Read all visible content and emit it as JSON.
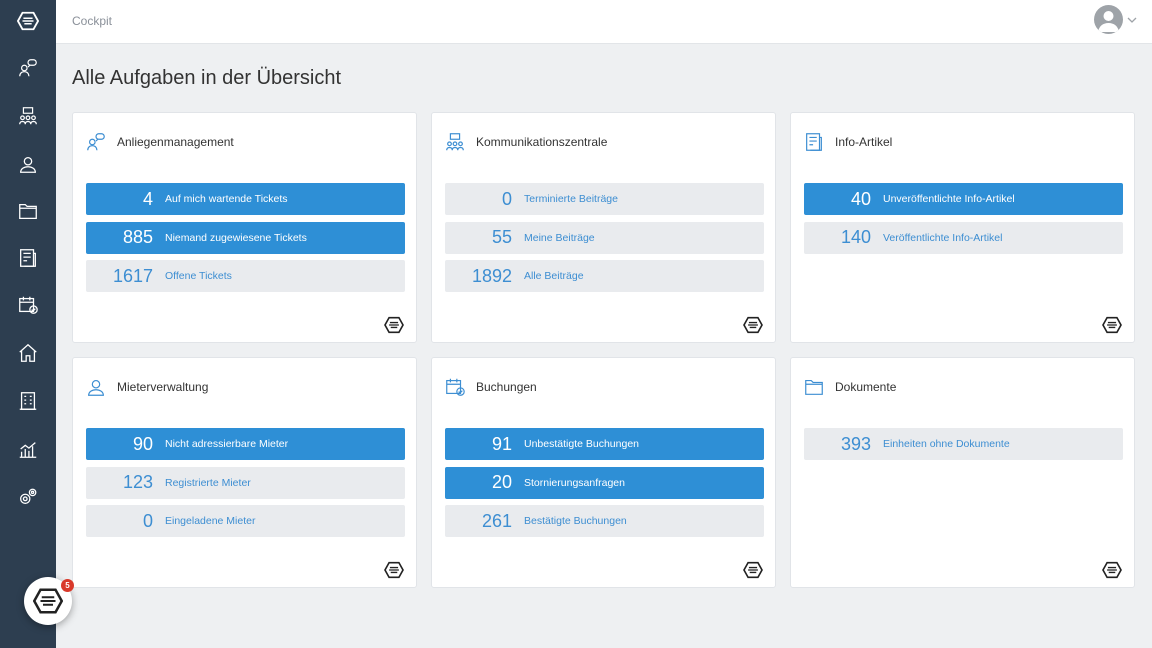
{
  "app": {
    "breadcrumb": "Cockpit",
    "page_title": "Alle Aufgaben in der Übersicht"
  },
  "colors": {
    "sidebar": "#2d3e50",
    "accent": "#2e8fd6",
    "link": "#3d8ed2",
    "row_muted": "#e9ebee",
    "badge": "#d9392b"
  },
  "sidebar": {
    "items": [
      {
        "icon": "logo-icon"
      },
      {
        "icon": "chat-person-icon"
      },
      {
        "icon": "people-group-icon"
      },
      {
        "icon": "person-icon"
      },
      {
        "icon": "folder-icon"
      },
      {
        "icon": "document-icon"
      },
      {
        "icon": "calendar-check-icon"
      },
      {
        "icon": "home-icon"
      },
      {
        "icon": "building-icon"
      },
      {
        "icon": "chart-icon"
      },
      {
        "icon": "gears-icon"
      }
    ]
  },
  "user": {
    "icon": "user-avatar-icon"
  },
  "cards": [
    {
      "title": "Anliegenmanagement",
      "icon": "chat-person-icon",
      "rows": [
        {
          "count": "4",
          "label": "Auf mich wartende Tickets",
          "highlight": true
        },
        {
          "count": "885",
          "label": "Niemand zugewiesene Tickets",
          "highlight": true
        },
        {
          "count": "1617",
          "label": "Offene Tickets",
          "highlight": false
        }
      ]
    },
    {
      "title": "Kommunikationszentrale",
      "icon": "people-group-icon",
      "rows": [
        {
          "count": "0",
          "label": "Terminierte Beiträge",
          "highlight": false
        },
        {
          "count": "55",
          "label": "Meine Beiträge",
          "highlight": false
        },
        {
          "count": "1892",
          "label": "Alle Beiträge",
          "highlight": false
        }
      ]
    },
    {
      "title": "Info-Artikel",
      "icon": "document-icon",
      "rows": [
        {
          "count": "40",
          "label": "Unveröffentlichte Info-Artikel",
          "highlight": true
        },
        {
          "count": "140",
          "label": "Veröffentlichte Info-Artikel",
          "highlight": false
        }
      ]
    },
    {
      "title": "Mieterverwaltung",
      "icon": "person-icon",
      "rows": [
        {
          "count": "90",
          "label": "Nicht adressierbare Mieter",
          "highlight": true
        },
        {
          "count": "123",
          "label": "Registrierte Mieter",
          "highlight": false
        },
        {
          "count": "0",
          "label": "Eingeladene Mieter",
          "highlight": false
        }
      ]
    },
    {
      "title": "Buchungen",
      "icon": "calendar-check-icon",
      "rows": [
        {
          "count": "91",
          "label": "Unbestätigte Buchungen",
          "highlight": true
        },
        {
          "count": "20",
          "label": "Stornierungsanfragen",
          "highlight": true
        },
        {
          "count": "261",
          "label": "Bestätigte Buchungen",
          "highlight": false
        }
      ]
    },
    {
      "title": "Dokumente",
      "icon": "folder-icon",
      "rows": [
        {
          "count": "393",
          "label": "Einheiten ohne Dokumente",
          "highlight": false
        }
      ]
    }
  ],
  "fab": {
    "badge": "5",
    "icon": "logo-icon"
  }
}
